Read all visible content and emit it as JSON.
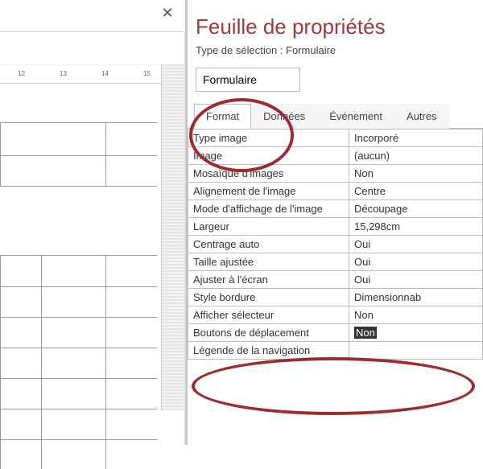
{
  "panel": {
    "title": "Feuille de propriétés",
    "subtitle": "Type de sélection : Formulaire",
    "selector_value": "Formulaire"
  },
  "tabs": {
    "format": "Format",
    "data": "Données",
    "event": "Événement",
    "other": "Autres"
  },
  "props": [
    {
      "label": "Type image",
      "value": "Incorporé"
    },
    {
      "label": "Image",
      "value": "(aucun)"
    },
    {
      "label": "Mosaïque d'images",
      "value": "Non"
    },
    {
      "label": "Alignement de l'image",
      "value": "Centre"
    },
    {
      "label": "Mode d'affichage de l'image",
      "value": "Découpage"
    },
    {
      "label": "Largeur",
      "value": "15,298cm"
    },
    {
      "label": "Centrage auto",
      "value": "Oui"
    },
    {
      "label": "Taille ajustée",
      "value": "Oui"
    },
    {
      "label": "Ajuster à l'écran",
      "value": "Oui"
    },
    {
      "label": "Style bordure",
      "value": "Dimensionnab"
    },
    {
      "label": "Afficher sélecteur",
      "value": "Non"
    },
    {
      "label": "Boutons de déplacement",
      "value": "Non",
      "selected": true
    },
    {
      "label": "Légende de la navigation",
      "value": ""
    }
  ],
  "ruler_marks": [
    "12",
    "13",
    "14",
    "15"
  ],
  "icons": {
    "close": "✕",
    "up": "▲"
  },
  "colors": {
    "accent": "#a4373a",
    "annotation": "#9e2b2f"
  }
}
